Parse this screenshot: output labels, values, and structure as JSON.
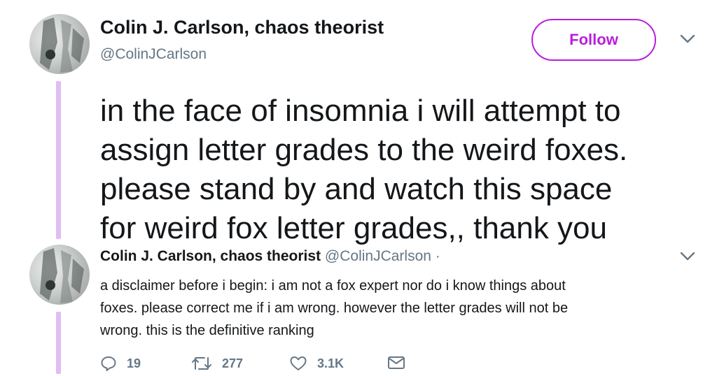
{
  "main_tweet": {
    "display_name": "Colin J. Carlson, chaos theorist",
    "handle": "@ColinJCarlson",
    "follow_label": "Follow",
    "text_lines": [
      "in the face of insomnia i will attempt to",
      "assign letter grades to the weird foxes.",
      "please stand by and watch this space",
      "for weird fox letter grades,, thank you"
    ]
  },
  "reply_tweet": {
    "display_name": "Colin J. Carlson, chaos theorist",
    "handle": "@ColinJCarlson",
    "separator": "·",
    "text_lines": [
      "a disclaimer before i begin: i am not a fox expert nor do i know things about",
      "foxes. please correct me if i am wrong. however the letter grades will not be",
      "wrong. this is the definitive ranking"
    ],
    "actions": {
      "reply_count": "19",
      "retweet_count": "277",
      "like_count": "3.1K"
    }
  },
  "icons": [
    "chevron-down-icon",
    "reply-icon",
    "retweet-icon",
    "heart-icon",
    "mail-icon"
  ],
  "colors": {
    "accent": "#b81ee0",
    "thread_line": "#e1bdf3",
    "secondary_text": "#657786",
    "primary_text": "#14171a"
  }
}
